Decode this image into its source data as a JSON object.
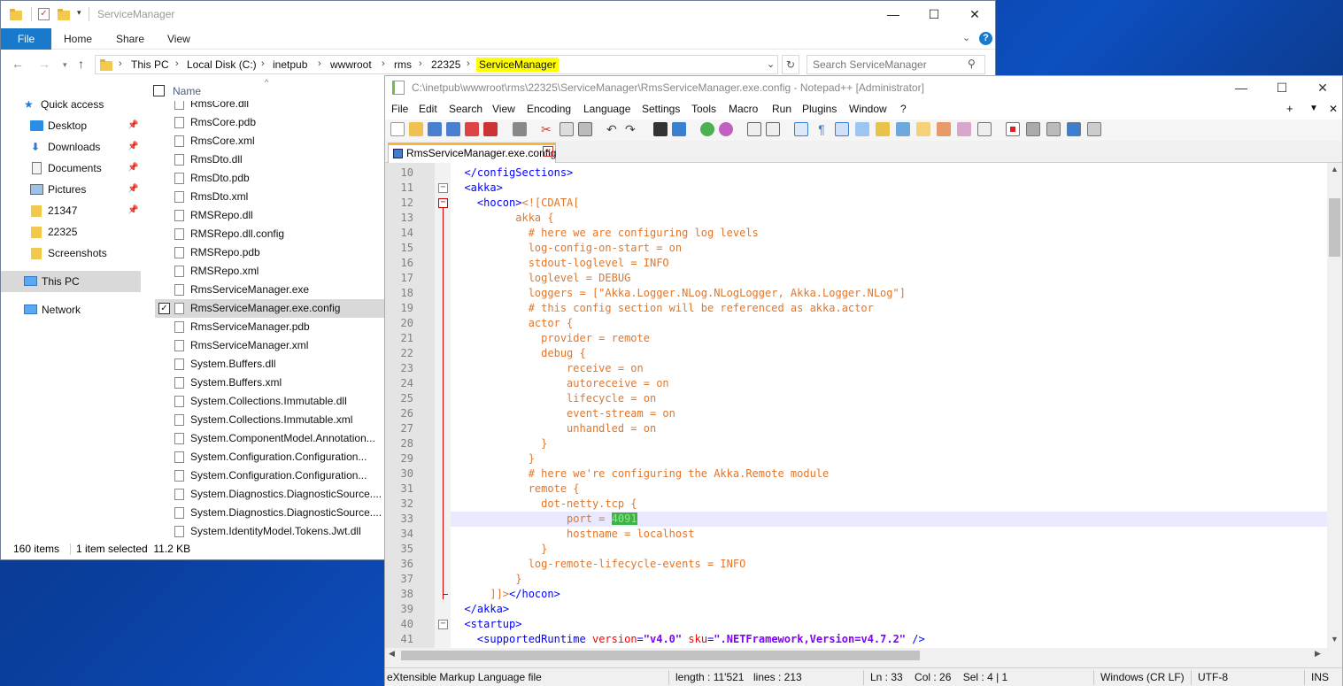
{
  "explorer": {
    "title": "ServiceManager",
    "ribbon_tabs": [
      "File",
      "Home",
      "Share",
      "View"
    ],
    "breadcrumbs": [
      "This PC",
      "Local Disk (C:)",
      "inetpub",
      "wwwroot",
      "rms",
      "22325",
      "ServiceManager"
    ],
    "search_placeholder": "Search ServiceManager",
    "column_header": "Name",
    "nav": [
      {
        "label": "Quick access",
        "icon": "star-icon"
      },
      {
        "label": "Desktop",
        "icon": "desktop-icon",
        "pinned": true
      },
      {
        "label": "Downloads",
        "icon": "download-icon",
        "pinned": true
      },
      {
        "label": "Documents",
        "icon": "documents-icon",
        "pinned": true
      },
      {
        "label": "Pictures",
        "icon": "pictures-icon",
        "pinned": true
      },
      {
        "label": "21347",
        "icon": "folder-icon",
        "pinned": true
      },
      {
        "label": "22325",
        "icon": "folder-icon"
      },
      {
        "label": "Screenshots",
        "icon": "folder-icon"
      },
      {
        "label": "This PC",
        "icon": "computer-icon",
        "selected": true
      },
      {
        "label": "Network",
        "icon": "network-icon"
      }
    ],
    "files": [
      "RmsCore.dll",
      "RmsCore.pdb",
      "RmsCore.xml",
      "RmsDto.dll",
      "RmsDto.pdb",
      "RmsDto.xml",
      "RMSRepo.dll",
      "RMSRepo.dll.config",
      "RMSRepo.pdb",
      "RMSRepo.xml",
      "RmsServiceManager.exe",
      "RmsServiceManager.exe.config",
      "RmsServiceManager.pdb",
      "RmsServiceManager.xml",
      "System.Buffers.dll",
      "System.Buffers.xml",
      "System.Collections.Immutable.dll",
      "System.Collections.Immutable.xml",
      "System.ComponentModel.Annotation...",
      "System.Configuration.Configuration...",
      "System.Configuration.Configuration...",
      "System.Diagnostics.DiagnosticSource....",
      "System.Diagnostics.DiagnosticSource....",
      "System.IdentityModel.Tokens.Jwt.dll"
    ],
    "selected_file_index": 11,
    "status_items": "160 items",
    "status_selected": "1 item selected  11.2 KB"
  },
  "npp": {
    "title": "C:\\inetpub\\wwwroot\\rms\\22325\\ServiceManager\\RmsServiceManager.exe.config - Notepad++ [Administrator]",
    "menu": [
      "File",
      "Edit",
      "Search",
      "View",
      "Encoding",
      "Language",
      "Settings",
      "Tools",
      "Macro",
      "Run",
      "Plugins",
      "Window",
      "?"
    ],
    "tab_label": "RmsServiceManager.exe.config",
    "current_line": 33,
    "lines": [
      {
        "n": "10",
        "html": "  <span class=\"tag\">&lt;/configSections&gt;</span>"
      },
      {
        "n": "11",
        "html": "  <span class=\"tag\">&lt;akka&gt;</span>"
      },
      {
        "n": "12",
        "html": "    <span class=\"tag\">&lt;hocon&gt;</span>&lt;![CDATA["
      },
      {
        "n": "13",
        "html": "          akka {"
      },
      {
        "n": "14",
        "html": "            # here we are configuring log levels"
      },
      {
        "n": "15",
        "html": "            log-config-on-start = on"
      },
      {
        "n": "16",
        "html": "            stdout-loglevel = INFO"
      },
      {
        "n": "17",
        "html": "            loglevel = DEBUG"
      },
      {
        "n": "18",
        "html": "            loggers = [\"Akka.Logger.NLog.NLogLogger, Akka.Logger.NLog\"]"
      },
      {
        "n": "19",
        "html": "            # this config section will be referenced as akka.actor"
      },
      {
        "n": "20",
        "html": "            actor {"
      },
      {
        "n": "21",
        "html": "              provider = remote"
      },
      {
        "n": "22",
        "html": "              debug {"
      },
      {
        "n": "23",
        "html": "                  receive = on"
      },
      {
        "n": "24",
        "html": "                  autoreceive = on"
      },
      {
        "n": "25",
        "html": "                  lifecycle = on"
      },
      {
        "n": "26",
        "html": "                  event-stream = on"
      },
      {
        "n": "27",
        "html": "                  unhandled = on"
      },
      {
        "n": "28",
        "html": "              }"
      },
      {
        "n": "29",
        "html": "            }"
      },
      {
        "n": "30",
        "html": "            # here we're configuring the Akka.Remote module"
      },
      {
        "n": "31",
        "html": "            remote {"
      },
      {
        "n": "32",
        "html": "              dot-netty.tcp {"
      },
      {
        "n": "33",
        "html": "                  port = <span style=\"background:#3bb34a;color:#9be37a\">4091</span>"
      },
      {
        "n": "34",
        "html": "                  hostname = localhost"
      },
      {
        "n": "35",
        "html": "              }"
      },
      {
        "n": "36",
        "html": "            log-remote-lifecycle-events = INFO"
      },
      {
        "n": "37",
        "html": "          }"
      },
      {
        "n": "38",
        "html": "      ]]&gt;<span class=\"tag\">&lt;/hocon&gt;</span>"
      },
      {
        "n": "39",
        "html": "  <span class=\"tag\">&lt;/akka&gt;</span>"
      },
      {
        "n": "40",
        "html": "  <span class=\"tag\">&lt;startup&gt;</span>"
      },
      {
        "n": "41",
        "html": "    <span class=\"tag\">&lt;supportedRuntime</span> <span class=\"atr\">version</span><span class=\"tag\">=</span><span class=\"str\">\"v4.0\"</span> <span class=\"atr\">sku</span><span class=\"tag\">=</span><span class=\"str\">\".NETFramework,Version=v4.7.2\"</span> <span class=\"tag\">/&gt;</span>"
      }
    ],
    "status": {
      "filetype": "eXtensible Markup Language file",
      "length": "length : 11'521",
      "lines": "lines : 213",
      "pos": "Ln : 33    Col : 26    Sel : 4 | 1",
      "eol": "Windows (CR LF)",
      "encoding": "UTF-8",
      "mode": "INS"
    }
  }
}
